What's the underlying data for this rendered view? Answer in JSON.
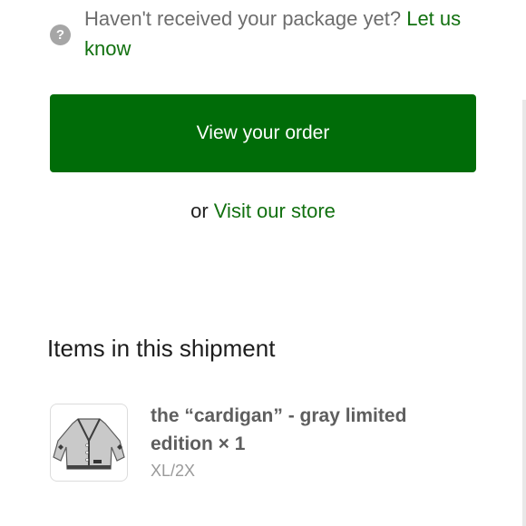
{
  "notice": {
    "help_icon": "question-mark-circle-icon",
    "text": "Haven't received your package yet?",
    "link_label": "Let us know"
  },
  "actions": {
    "view_order_label": "View your order",
    "or_text": "or",
    "visit_store_label": "Visit our store"
  },
  "shipment": {
    "title": "Items in this shipment",
    "items": [
      {
        "name": "the “cardigan” - gray limited edition",
        "quantity": "× 1",
        "variant": "XL/2X"
      }
    ]
  },
  "colors": {
    "accent": "#006c08",
    "link": "#11700f"
  }
}
